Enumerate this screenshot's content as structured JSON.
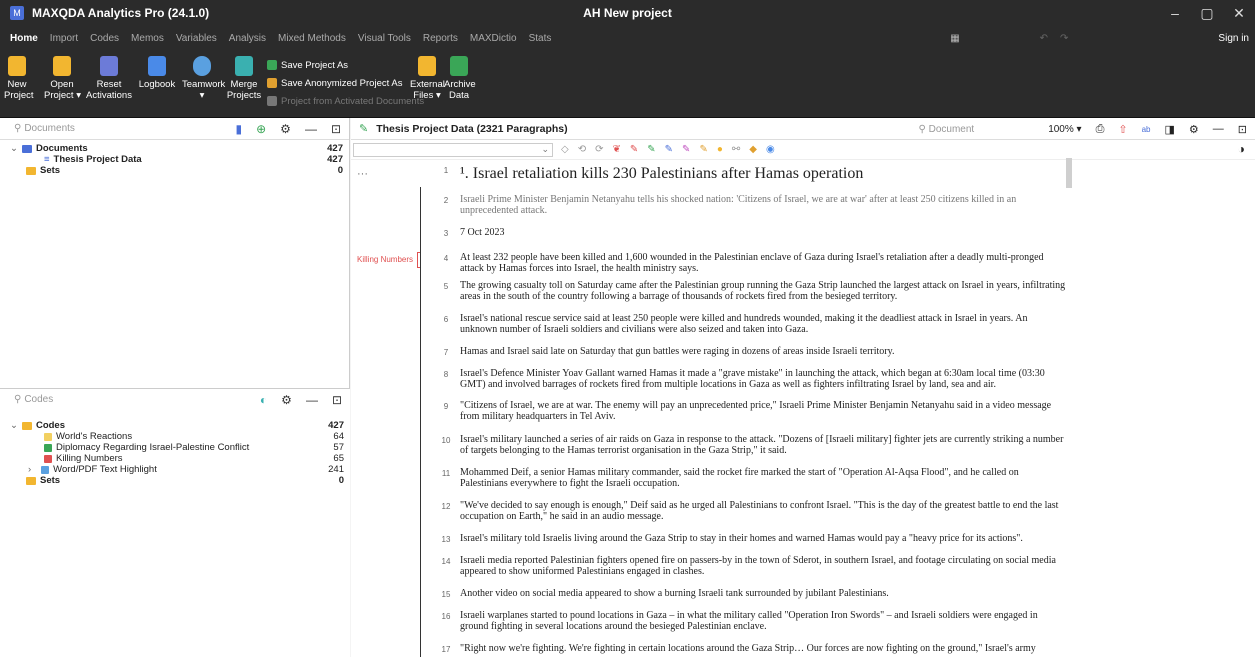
{
  "window": {
    "app_title": "MAXQDA Analytics Pro (24.1.0)",
    "doc_title": "AH New project",
    "min": "–",
    "max": "▢",
    "close": "✕"
  },
  "menu": {
    "tabs": [
      "Home",
      "Import",
      "Codes",
      "Memos",
      "Variables",
      "Analysis",
      "Mixed Methods",
      "Visual Tools",
      "Reports",
      "MAXDictio",
      "Stats"
    ],
    "sign_in": "Sign in"
  },
  "ribbon": {
    "new_project": "New\nProject",
    "open_project": "Open\nProject ▾",
    "reset_activations": "Reset\nActivations",
    "logbook": "Logbook",
    "teamwork": "Teamwork\n▾",
    "merge_projects": "Merge\nProjects",
    "save_project_as": "Save Project As",
    "save_anon": "Save Anonymized Project As",
    "project_from_activated": "Project from Activated Documents",
    "external_files": "External\nFiles ▾",
    "archive_data": "Archive\nData"
  },
  "documents_panel": {
    "search_placeholder": "Documents",
    "root_label": "Documents",
    "root_count": "427",
    "child_label": "Thesis Project Data",
    "child_count": "427",
    "sets_label": "Sets",
    "sets_count": "0"
  },
  "codes_panel": {
    "search_placeholder": "Codes",
    "root_label": "Codes",
    "root_count": "427",
    "items": [
      {
        "label": "World's Reactions",
        "count": "64"
      },
      {
        "label": "Diplomacy Regarding Israel-Palestine Conflict",
        "count": "57"
      },
      {
        "label": "Killing Numbers",
        "count": "65"
      },
      {
        "label": "Word/PDF Text Highlight",
        "count": "241"
      }
    ],
    "sets_label": "Sets",
    "sets_count": "0"
  },
  "document_browser": {
    "title": "Thesis Project Data  (2321 Paragraphs)",
    "search_placeholder": "Document",
    "zoom": "100% ▾",
    "code_marker": "Killing Numbers",
    "ellipsis": "···",
    "paragraphs": [
      {
        "n": "1",
        "text": "¹. Israel retaliation kills 230 Palestinians after Hamas operation"
      },
      {
        "n": "2",
        "text": "Israeli Prime Minister Benjamin Netanyahu tells his shocked nation: 'Citizens of Israel, we are at war' after at least 250 citizens killed in an unprecedented attack."
      },
      {
        "n": "3",
        "text": "7 Oct 2023"
      },
      {
        "n": "4",
        "text": "At least 232 people have been killed and 1,600 wounded in the Palestinian enclave of Gaza during Israel's retaliation after a deadly multi-pronged attack by Hamas forces into Israel, the health ministry says."
      },
      {
        "n": "5",
        "text": "The growing casualty toll on Saturday came after the Palestinian group running the Gaza Strip launched the largest attack on Israel in years, infiltrating areas in the south of the country following a barrage of thousands of rockets fired from the besieged territory."
      },
      {
        "n": "6",
        "text": "Israel's national rescue service said at least 250 people were killed and hundreds wounded, making it the deadliest attack in Israel in years. An unknown number of Israeli soldiers and civilians were also seized and taken into Gaza."
      },
      {
        "n": "7",
        "text": "Hamas and Israel said late on Saturday that gun battles were raging in dozens of areas inside Israeli territory."
      },
      {
        "n": "8",
        "text": "Israel's Defence Minister Yoav Gallant warned Hamas it made a \"grave mistake\" in launching the attack, which began at 6:30am local time (03:30 GMT) and involved barrages of rockets fired from multiple locations in Gaza as well as fighters infiltrating Israel by land, sea and air."
      },
      {
        "n": "9",
        "text": "\"Citizens of Israel, we are at war. The enemy will pay an unprecedented price,\" Israeli Prime Minister Benjamin Netanyahu said in a video message from military headquarters in Tel Aviv."
      },
      {
        "n": "10",
        "text": "Israel's military launched a series of air raids on Gaza in response to the attack. \"Dozens of [Israeli military] fighter jets are currently striking a number of targets belonging to the Hamas terrorist organisation in the Gaza Strip,\" it said."
      },
      {
        "n": "11",
        "text": "Mohammed Deif, a senior Hamas military commander, said the rocket fire marked the start of \"Operation Al-Aqsa Flood\", and he called on Palestinians everywhere to fight the Israeli occupation."
      },
      {
        "n": "12",
        "text": "\"We've decided to say enough is enough,\" Deif said as he urged all Palestinians to confront Israel. \"This is the day of the greatest battle to end the last occupation on Earth,\" he said in an audio message."
      },
      {
        "n": "13",
        "text": "Israel's military told Israelis living around the Gaza Strip to stay in their homes and warned Hamas would pay a \"heavy price for its actions\"."
      },
      {
        "n": "14",
        "text": "Israeli media reported Palestinian fighters opened fire on passers-by in the town of Sderot, in southern Israel, and footage circulating on social media appeared to show uniformed Palestinians engaged in clashes."
      },
      {
        "n": "15",
        "text": "Another video on social media appeared to show a burning Israeli tank surrounded by jubilant Palestinians."
      },
      {
        "n": "16",
        "text": "Israeli warplanes started to pound locations in Gaza – in what the military called \"Operation Iron Swords\" – and Israeli soldiers were engaged in ground fighting in several locations around the besieged Palestinian enclave."
      },
      {
        "n": "17",
        "text": "\"Right now we're fighting. We're fighting in certain locations around the Gaza Strip… Our forces are now fighting on the ground,\" Israel's army"
      }
    ]
  },
  "colors": {
    "chrome": "#2b2b2b",
    "accent_blue": "#4a6fd8",
    "code_red": "#e05050",
    "folder_yellow": "#f2b630",
    "green": "#3aa657"
  }
}
